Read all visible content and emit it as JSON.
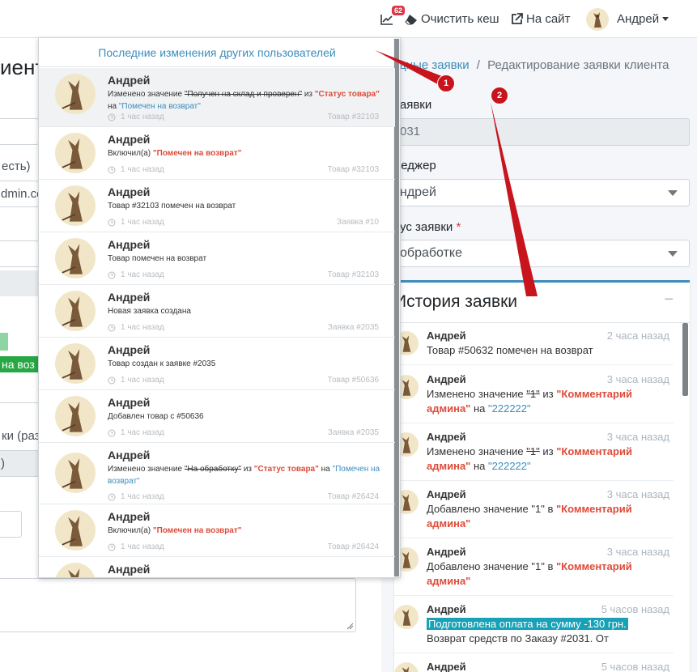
{
  "navbar": {
    "notification_count": "62",
    "clear_cache": "Очистить кеш",
    "to_site": "На сайт",
    "user_name": "Андрей"
  },
  "left_fragments": {
    "title": "иенто",
    "field_hint": "есть)",
    "email": "dmin.co",
    "status_badge": "на воз",
    "textarea_label": "ки (раз",
    "gray_field": ")"
  },
  "breadcrumb": {
    "link": "дные заявки",
    "separator": "/",
    "current": "Редактирование заявки клиента"
  },
  "form": {
    "order_label": "заявки",
    "order_value": "031",
    "manager_label": "неджер",
    "manager_value": "ндрей",
    "status_label": "тус заявки",
    "required_mark": "*",
    "status_value": "обработке"
  },
  "history": {
    "title": "История заявки",
    "collapse": "−",
    "items": [
      {
        "name": "Андрей",
        "time": "2 часа назад",
        "text": "Товар #50632 помечен на возврат"
      },
      {
        "name": "Андрей",
        "time": "3 часа назад",
        "text_pre": "Изменено значение",
        "old": "\"1\"",
        "from": "из",
        "field": "\"Комментарий админа\"",
        "to": "на",
        "new": "\"222222\""
      },
      {
        "name": "Андрей",
        "time": "3 часа назад",
        "text_pre": "Изменено значение",
        "old": "\"1\"",
        "from": "из",
        "field": "\"Комментарий админа\"",
        "to": "на",
        "new": "\"222222\""
      },
      {
        "name": "Андрей",
        "time": "3 часа назад",
        "text_pre": "Добавлено значение \"1\" в",
        "field": "\"Комментарий админа\""
      },
      {
        "name": "Андрей",
        "time": "3 часа назад",
        "text_pre": "Добавлено значение \"1\" в",
        "field": "\"Комментарий админа\""
      },
      {
        "name": "Андрей",
        "time": "5 часов назад",
        "highlight": "Подготовлена оплата на сумму -130 грн.",
        "text": "Возврат средств по Заказу #2031. От"
      },
      {
        "name": "Андрей",
        "time": "5 часов назад"
      }
    ]
  },
  "notifications": {
    "header": "Последние изменения других пользователей",
    "items": [
      {
        "name": "Андрей",
        "t1": "Изменено значение",
        "old": "\"Получен на склад и проверен\"",
        "t2": "из",
        "field": "\"Статус товара\"",
        "t3": "на",
        "new": "\"Помечен на возврат\"",
        "time": "1 час назад",
        "ref": "Товар #32103"
      },
      {
        "name": "Андрей",
        "t1": "Включил(а)",
        "field": "\"Помечен на возврат\"",
        "time": "1 час назад",
        "ref": "Товар #32103"
      },
      {
        "name": "Андрей",
        "t1": "Товар #32103 помечен на возврат",
        "time": "1 час назад",
        "ref": "Заявка #10"
      },
      {
        "name": "Андрей",
        "t1": "Товар помечен на возврат",
        "time": "1 час назад",
        "ref": "Товар #32103"
      },
      {
        "name": "Андрей",
        "t1": "Новая заявка создана",
        "time": "1 час назад",
        "ref": "Заявка #2035"
      },
      {
        "name": "Андрей",
        "t1": "Товар создан к заявке #2035",
        "time": "1 час назад",
        "ref": "Товар #50636"
      },
      {
        "name": "Андрей",
        "t1": "Добавлен товар с #50636",
        "time": "1 час назад",
        "ref": "Заявка #2035"
      },
      {
        "name": "Андрей",
        "t1": "Изменено значение",
        "old": "\"На обработку\"",
        "t2": "из",
        "field": "\"Статус товара\"",
        "t3": "на",
        "new": "\"Помечен на возврат\"",
        "time": "1 час назад",
        "ref": "Товар #26424"
      },
      {
        "name": "Андрей",
        "t1": "Включил(а)",
        "field": "\"Помечен на возврат\"",
        "time": "1 час назад",
        "ref": "Товар #26424"
      },
      {
        "name": "Андрей"
      }
    ]
  },
  "markers": {
    "one": "1",
    "two": "2"
  },
  "colors": {
    "accent": "#3c8dbc",
    "danger": "#dd4b39",
    "badge": "#dc3545",
    "highlight": "#17a2b8",
    "arrow": "#c8141c"
  }
}
